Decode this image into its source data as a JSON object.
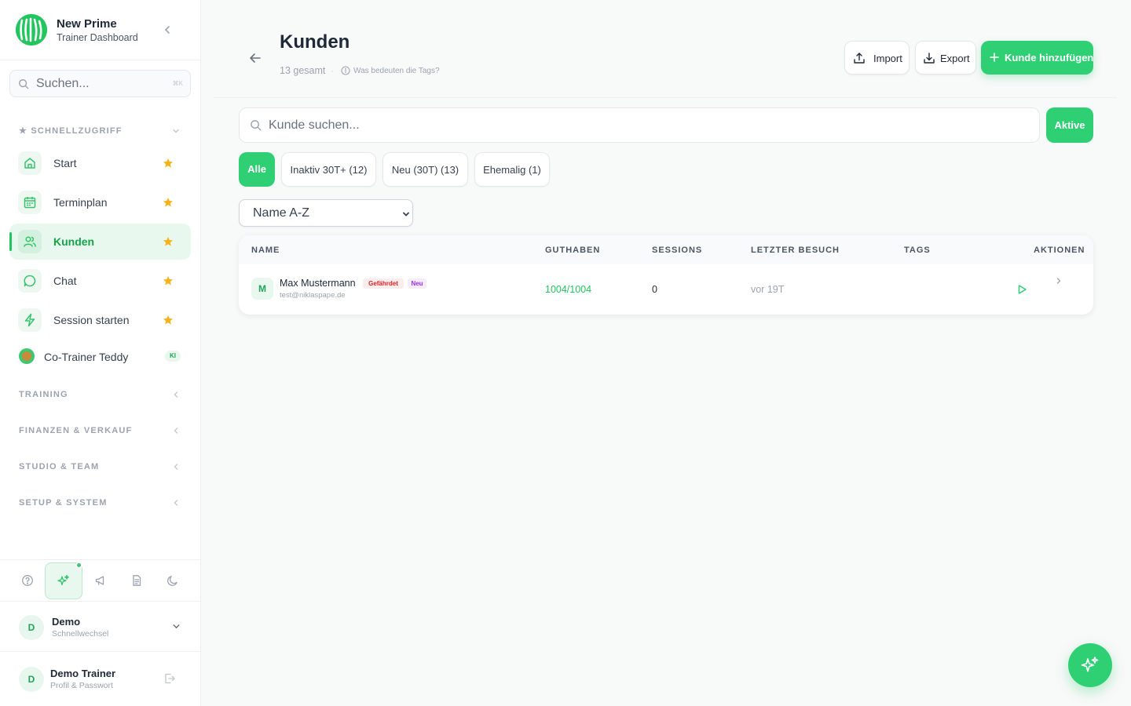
{
  "brand": {
    "title": "New Prime",
    "subtitle": "Trainer Dashboard"
  },
  "sidebar": {
    "search": {
      "placeholder": "Suchen...",
      "shortcut": "⌘K"
    },
    "quick_access": {
      "title": "SCHNELLZUGRIFF",
      "items": [
        {
          "label": "Start",
          "icon": "home-icon",
          "active": false
        },
        {
          "label": "Terminplan",
          "icon": "calendar-icon",
          "active": false
        },
        {
          "label": "Kunden",
          "icon": "users-icon",
          "active": true
        },
        {
          "label": "Chat",
          "icon": "chat-icon",
          "active": false
        },
        {
          "label": "Session starten",
          "icon": "bolt-icon",
          "active": false
        }
      ]
    },
    "cotrainer": {
      "label": "Co-Trainer Teddy",
      "badge": "KI"
    },
    "sections": [
      "TRAINING",
      "FINANZEN & VERKAUF",
      "STUDIO & TEAM",
      "SETUP & SYSTEM"
    ],
    "tools": [
      "help-icon",
      "sparkles-icon",
      "megaphone-icon",
      "document-icon",
      "moon-icon"
    ],
    "studio": {
      "initial": "D",
      "name": "Demo",
      "sub": "Schnellwechsel"
    },
    "user": {
      "initial": "D",
      "name": "Demo Trainer",
      "sub": "Profil & Passwort"
    }
  },
  "header": {
    "title": "Kunden",
    "count": "13 gesamt",
    "separator": "·",
    "tags_help": "Was bedeuten die Tags?",
    "import_label": "Import",
    "export_label": "Export",
    "add_label": "Kunde hinzufügen"
  },
  "filters": {
    "search_placeholder": "Kunde suchen...",
    "active_button": "Aktive",
    "chips": [
      "Alle",
      "Inaktiv 30T+ (12)",
      "Neu (30T) (13)",
      "Ehemalig (1)"
    ],
    "active_chip": "Alle",
    "sort_value": "Name A-Z"
  },
  "table": {
    "headers": [
      "NAME",
      "GUTHABEN",
      "SESSIONS",
      "LETZTER BESUCH",
      "TAGS",
      "AKTIONEN"
    ],
    "rows": [
      {
        "initial": "M",
        "name": "Max Mustermann",
        "email": "test@niklaspape.de",
        "badges": [
          "Gefährdet",
          "Neu"
        ],
        "credit": "1004/1004",
        "sessions": "0",
        "last_visit": "vor 19T"
      }
    ]
  },
  "colors": {
    "accent": "#2fd074",
    "accent_dark": "#16a34a",
    "star": "#f6b21a",
    "danger": "#dc2626",
    "purple": "#9333ea"
  }
}
